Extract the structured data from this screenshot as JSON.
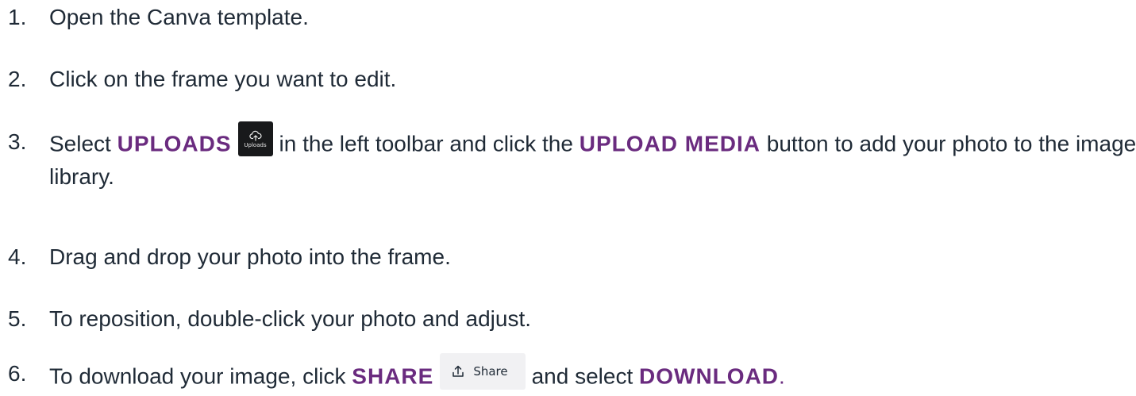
{
  "steps": [
    {
      "number": "1.",
      "text": "Open the Canva template."
    },
    {
      "number": "2.",
      "text": "Click on the frame you want to edit."
    },
    {
      "number": "3.",
      "prefix": "Select",
      "keyword1": "UPLOADS",
      "uploads_button_label": "Uploads",
      "uploads_icon": "cloud-upload-icon",
      "middle": "in the left toolbar and click the",
      "keyword2": "UPLOAD MEDIA",
      "suffix": "button to add your photo to the image library."
    },
    {
      "number": "4.",
      "text": "Drag and drop your photo into the frame."
    },
    {
      "number": "5.",
      "text": "To reposition, double-click your photo and adjust."
    },
    {
      "number": "6.",
      "prefix": "To download your image, click",
      "keyword1": "SHARE",
      "share_button_label": "Share",
      "share_icon": "share-upload-icon",
      "middle": "and select",
      "keyword2": "DOWNLOAD",
      "end_punct": "."
    }
  ],
  "colors": {
    "text": "#1f2a36",
    "keyword": "#6a2b7f",
    "uploads_button_bg": "#18191b",
    "share_button_bg": "#f1f1f3"
  }
}
